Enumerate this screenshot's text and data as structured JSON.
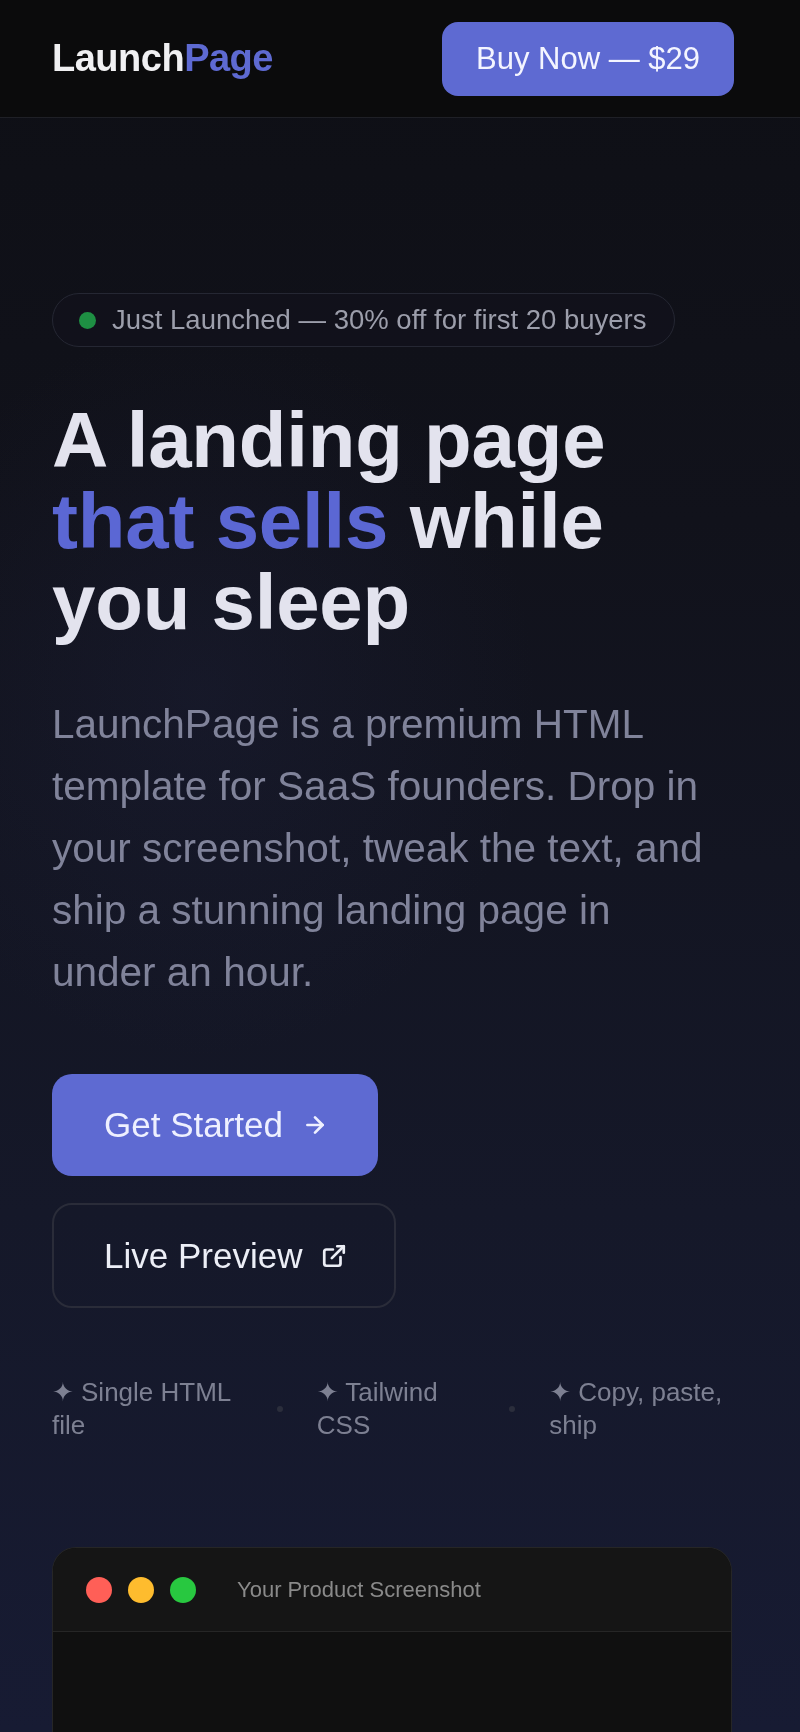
{
  "header": {
    "logo": {
      "text": "Launch",
      "accent": "Page"
    },
    "cta": "Buy Now — $29"
  },
  "hero": {
    "badge": "Just Launched — 30% off for first 20 buyers",
    "headline": {
      "before": "A landing page",
      "highlight": "that sells",
      "after": "while you sleep"
    },
    "description": "LaunchPage is a premium HTML template for SaaS founders. Drop in your screenshot, tweak the text, and ship a stunning landing page in under an hour.",
    "actions": [
      {
        "label": "Get Started",
        "kind": "primary"
      },
      {
        "label": "Live Preview",
        "kind": "secondary"
      }
    ],
    "features": [
      "✦ Single HTML file",
      "✦ Tailwind CSS",
      "✦ Copy, paste, ship"
    ]
  },
  "preview": {
    "title": "Your Product Screenshot"
  }
}
